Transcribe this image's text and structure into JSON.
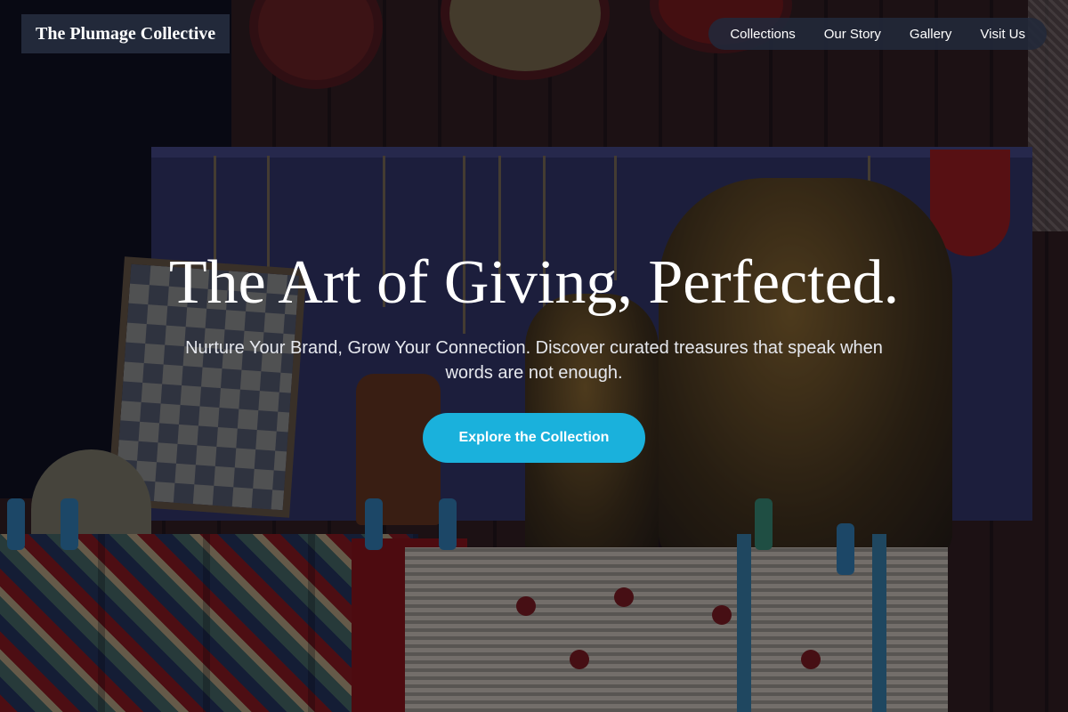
{
  "brand": {
    "name": "The Plumage Collective",
    "bg_color": "#22293a"
  },
  "nav": {
    "items": [
      {
        "label": "Collections"
      },
      {
        "label": "Our Story"
      },
      {
        "label": "Gallery"
      },
      {
        "label": "Visit Us"
      }
    ]
  },
  "hero": {
    "headline": "The Art of Giving, Perfected.",
    "subtitle": "Nurture Your Brand, Grow Your Connection. Discover curated treasures that speak when words are not enough.",
    "cta_label": "Explore the Collection",
    "cta_color": "#1ab1dc"
  }
}
